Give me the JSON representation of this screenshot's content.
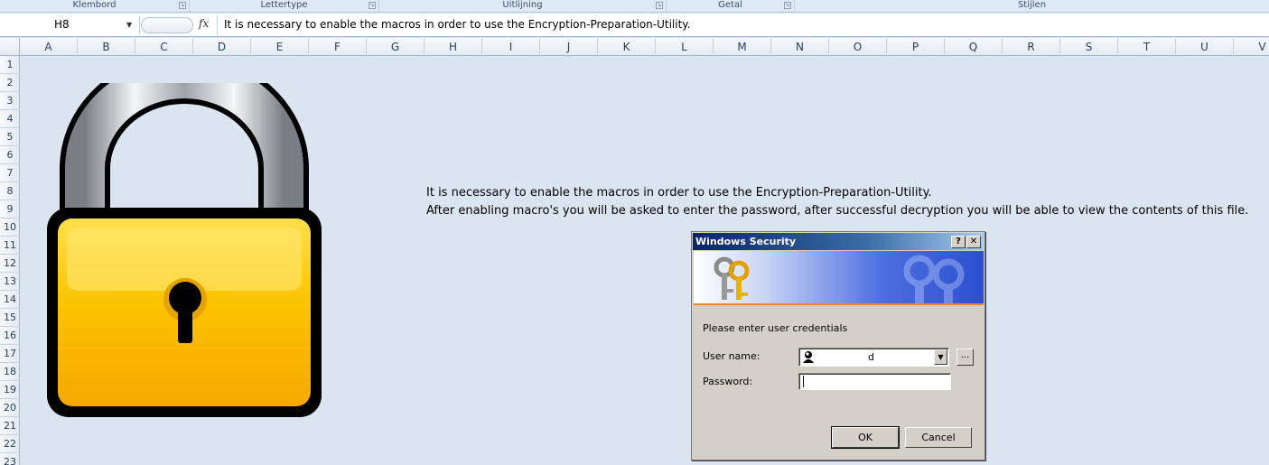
{
  "ribbon": {
    "groups": [
      "Klembord",
      "Lettertype",
      "Uitlijning",
      "Getal",
      "Stijlen"
    ]
  },
  "formula_bar": {
    "cell_ref": "H8",
    "fx_label": "fx",
    "content": "It is necessary to enable the macros in order to use the Encryption-Preparation-Utility."
  },
  "sheet": {
    "columns": [
      "A",
      "B",
      "C",
      "D",
      "E",
      "F",
      "G",
      "H",
      "I",
      "J",
      "K",
      "L",
      "M",
      "N",
      "O",
      "P",
      "Q",
      "R",
      "S",
      "T",
      "U",
      "V"
    ],
    "rows": [
      "1",
      "2",
      "3",
      "4",
      "5",
      "6",
      "7",
      "8",
      "9",
      "10",
      "11",
      "12",
      "13",
      "14",
      "15",
      "16",
      "17",
      "18",
      "19",
      "20",
      "21",
      "22",
      "23"
    ],
    "message_line1": "It is necessary to enable the macros in order to use the Encryption-Preparation-Utility.",
    "message_line2": "After enabling macro's you will be asked to enter the password, after successful decryption you will be able to view the contents of this file."
  },
  "dialog": {
    "title": "Windows Security",
    "help_label": "?",
    "close_label": "✕",
    "prompt": "Please enter user credentials",
    "username_label": "User name:",
    "username_value": "d",
    "password_label": "Password:",
    "browse_label": "...",
    "ok_label": "OK",
    "cancel_label": "Cancel"
  },
  "colors": {
    "sheet_bg": "#dbe5f1",
    "lock_body": "#f5b800",
    "dialog_title": "#0a246a"
  }
}
